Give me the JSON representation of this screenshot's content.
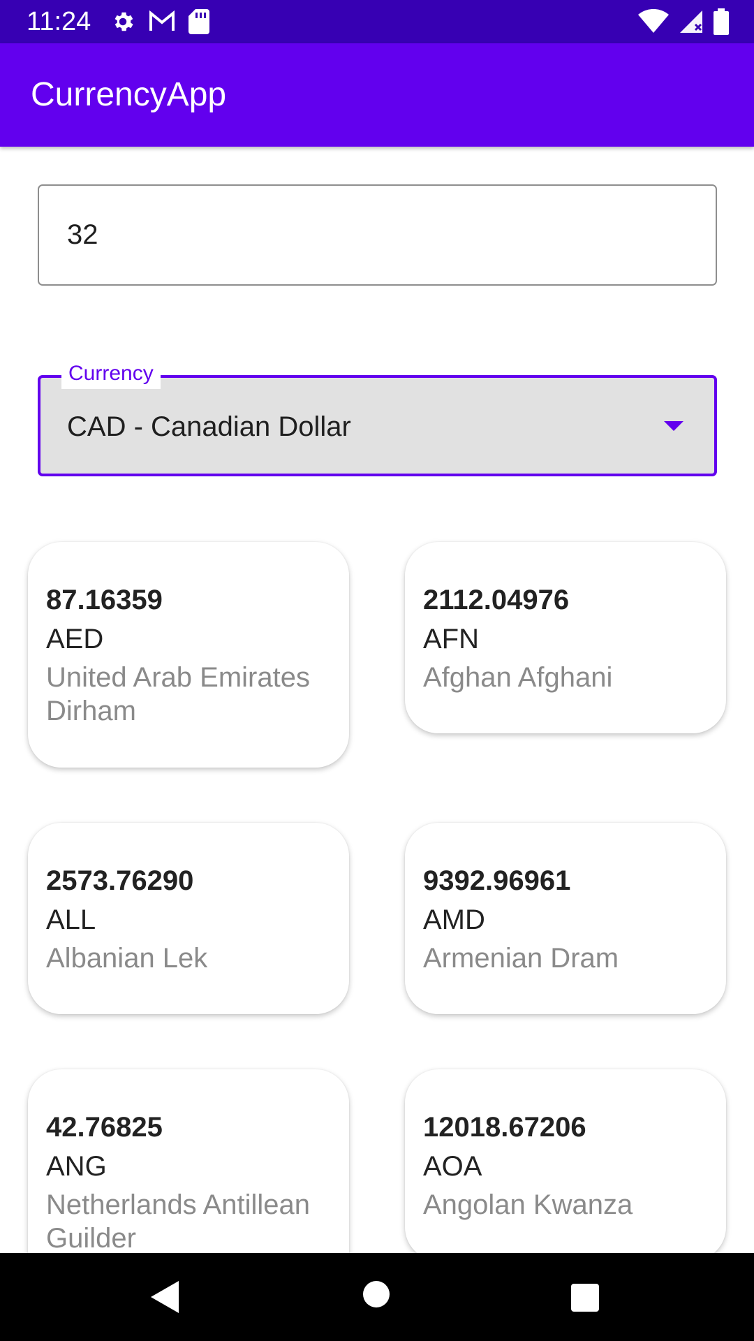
{
  "status_bar": {
    "time": "11:24",
    "left_icons": [
      "gear-icon",
      "gmail-icon",
      "sd-card-icon"
    ],
    "right_icons": [
      "wifi-icon",
      "signal-icon",
      "battery-icon"
    ]
  },
  "app_bar": {
    "title": "CurrencyApp",
    "color": "#6200ee"
  },
  "amount_input": {
    "value": "32"
  },
  "currency_select": {
    "label": "Currency",
    "selected": "CAD - Canadian Dollar",
    "accent_color": "#6200ee"
  },
  "rates": [
    {
      "amount": "87.16359",
      "code": "AED",
      "name": "United Arab Emirates Dirham"
    },
    {
      "amount": "2112.04976",
      "code": "AFN",
      "name": "Afghan Afghani"
    },
    {
      "amount": "2573.76290",
      "code": "ALL",
      "name": "Albanian Lek"
    },
    {
      "amount": "9392.96961",
      "code": "AMD",
      "name": "Armenian Dram"
    },
    {
      "amount": "42.76825",
      "code": "ANG",
      "name": "Netherlands Antillean Guilder"
    },
    {
      "amount": "12018.67206",
      "code": "AOA",
      "name": "Angolan Kwanza"
    }
  ],
  "nav_bar": {
    "buttons": [
      "back-icon",
      "home-icon",
      "recents-icon"
    ]
  }
}
